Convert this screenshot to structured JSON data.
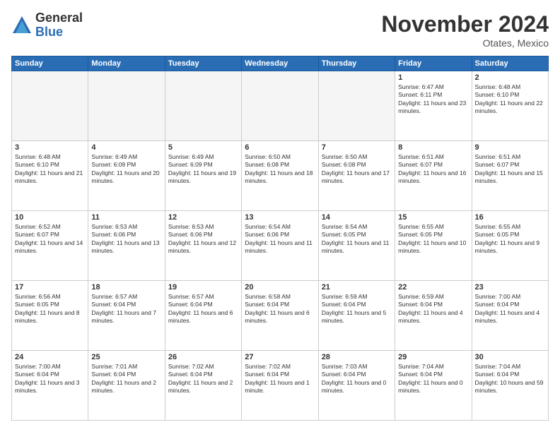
{
  "logo": {
    "general": "General",
    "blue": "Blue"
  },
  "title": "November 2024",
  "location": "Otates, Mexico",
  "days_header": [
    "Sunday",
    "Monday",
    "Tuesday",
    "Wednesday",
    "Thursday",
    "Friday",
    "Saturday"
  ],
  "weeks": [
    [
      {
        "day": "",
        "info": ""
      },
      {
        "day": "",
        "info": ""
      },
      {
        "day": "",
        "info": ""
      },
      {
        "day": "",
        "info": ""
      },
      {
        "day": "",
        "info": ""
      },
      {
        "day": "1",
        "info": "Sunrise: 6:47 AM\nSunset: 6:11 PM\nDaylight: 11 hours and 23 minutes."
      },
      {
        "day": "2",
        "info": "Sunrise: 6:48 AM\nSunset: 6:10 PM\nDaylight: 11 hours and 22 minutes."
      }
    ],
    [
      {
        "day": "3",
        "info": "Sunrise: 6:48 AM\nSunset: 6:10 PM\nDaylight: 11 hours and 21 minutes."
      },
      {
        "day": "4",
        "info": "Sunrise: 6:49 AM\nSunset: 6:09 PM\nDaylight: 11 hours and 20 minutes."
      },
      {
        "day": "5",
        "info": "Sunrise: 6:49 AM\nSunset: 6:09 PM\nDaylight: 11 hours and 19 minutes."
      },
      {
        "day": "6",
        "info": "Sunrise: 6:50 AM\nSunset: 6:08 PM\nDaylight: 11 hours and 18 minutes."
      },
      {
        "day": "7",
        "info": "Sunrise: 6:50 AM\nSunset: 6:08 PM\nDaylight: 11 hours and 17 minutes."
      },
      {
        "day": "8",
        "info": "Sunrise: 6:51 AM\nSunset: 6:07 PM\nDaylight: 11 hours and 16 minutes."
      },
      {
        "day": "9",
        "info": "Sunrise: 6:51 AM\nSunset: 6:07 PM\nDaylight: 11 hours and 15 minutes."
      }
    ],
    [
      {
        "day": "10",
        "info": "Sunrise: 6:52 AM\nSunset: 6:07 PM\nDaylight: 11 hours and 14 minutes."
      },
      {
        "day": "11",
        "info": "Sunrise: 6:53 AM\nSunset: 6:06 PM\nDaylight: 11 hours and 13 minutes."
      },
      {
        "day": "12",
        "info": "Sunrise: 6:53 AM\nSunset: 6:06 PM\nDaylight: 11 hours and 12 minutes."
      },
      {
        "day": "13",
        "info": "Sunrise: 6:54 AM\nSunset: 6:06 PM\nDaylight: 11 hours and 11 minutes."
      },
      {
        "day": "14",
        "info": "Sunrise: 6:54 AM\nSunset: 6:05 PM\nDaylight: 11 hours and 11 minutes."
      },
      {
        "day": "15",
        "info": "Sunrise: 6:55 AM\nSunset: 6:05 PM\nDaylight: 11 hours and 10 minutes."
      },
      {
        "day": "16",
        "info": "Sunrise: 6:55 AM\nSunset: 6:05 PM\nDaylight: 11 hours and 9 minutes."
      }
    ],
    [
      {
        "day": "17",
        "info": "Sunrise: 6:56 AM\nSunset: 6:05 PM\nDaylight: 11 hours and 8 minutes."
      },
      {
        "day": "18",
        "info": "Sunrise: 6:57 AM\nSunset: 6:04 PM\nDaylight: 11 hours and 7 minutes."
      },
      {
        "day": "19",
        "info": "Sunrise: 6:57 AM\nSunset: 6:04 PM\nDaylight: 11 hours and 6 minutes."
      },
      {
        "day": "20",
        "info": "Sunrise: 6:58 AM\nSunset: 6:04 PM\nDaylight: 11 hours and 6 minutes."
      },
      {
        "day": "21",
        "info": "Sunrise: 6:59 AM\nSunset: 6:04 PM\nDaylight: 11 hours and 5 minutes."
      },
      {
        "day": "22",
        "info": "Sunrise: 6:59 AM\nSunset: 6:04 PM\nDaylight: 11 hours and 4 minutes."
      },
      {
        "day": "23",
        "info": "Sunrise: 7:00 AM\nSunset: 6:04 PM\nDaylight: 11 hours and 4 minutes."
      }
    ],
    [
      {
        "day": "24",
        "info": "Sunrise: 7:00 AM\nSunset: 6:04 PM\nDaylight: 11 hours and 3 minutes."
      },
      {
        "day": "25",
        "info": "Sunrise: 7:01 AM\nSunset: 6:04 PM\nDaylight: 11 hours and 2 minutes."
      },
      {
        "day": "26",
        "info": "Sunrise: 7:02 AM\nSunset: 6:04 PM\nDaylight: 11 hours and 2 minutes."
      },
      {
        "day": "27",
        "info": "Sunrise: 7:02 AM\nSunset: 6:04 PM\nDaylight: 11 hours and 1 minute."
      },
      {
        "day": "28",
        "info": "Sunrise: 7:03 AM\nSunset: 6:04 PM\nDaylight: 11 hours and 0 minutes."
      },
      {
        "day": "29",
        "info": "Sunrise: 7:04 AM\nSunset: 6:04 PM\nDaylight: 11 hours and 0 minutes."
      },
      {
        "day": "30",
        "info": "Sunrise: 7:04 AM\nSunset: 6:04 PM\nDaylight: 10 hours and 59 minutes."
      }
    ]
  ]
}
